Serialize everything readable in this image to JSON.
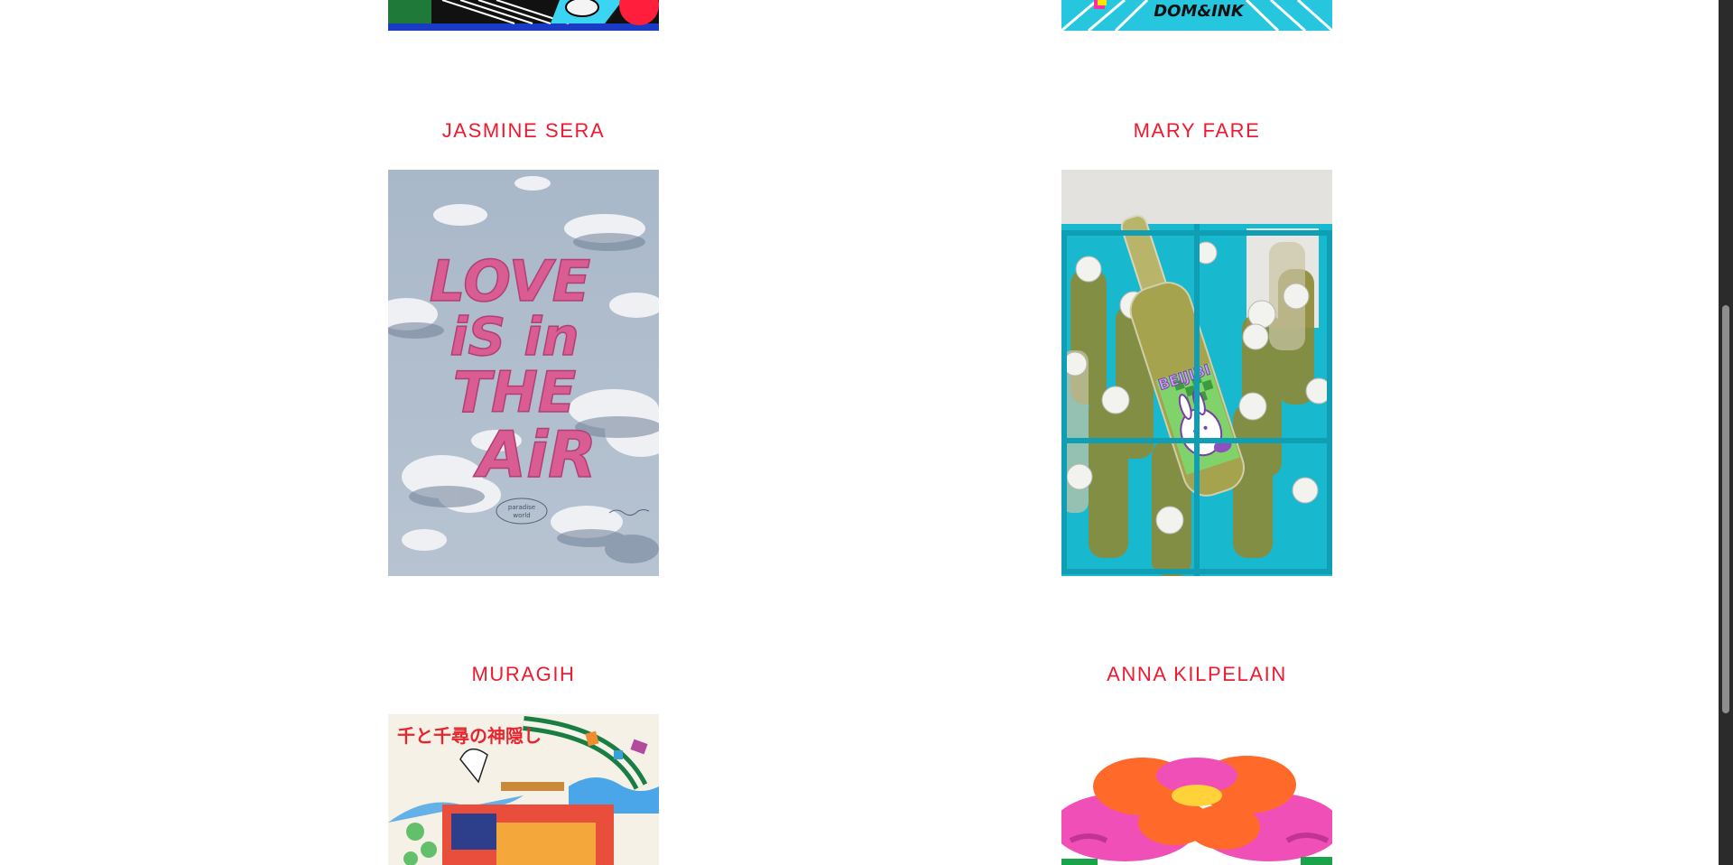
{
  "artists": [
    {
      "name": "JASMINE SERA",
      "artwork_text": [
        "LOVE",
        "iS in",
        "THE",
        "AiR"
      ],
      "logo_text": [
        "paradise",
        "world"
      ]
    },
    {
      "name": "MARY FARE",
      "label_text": "BEIJIBI"
    },
    {
      "name": "MURAGIH",
      "poster_title": "千と千尋の神隠し"
    },
    {
      "name": "ANNA KILPELAIN"
    }
  ],
  "top_row": {
    "right_poster_text": "DOM&INK"
  },
  "colors": {
    "accent": "#ee1a2f",
    "scrollbar_track": "#2b2b2b",
    "scrollbar_thumb": "#8e8e8e"
  }
}
